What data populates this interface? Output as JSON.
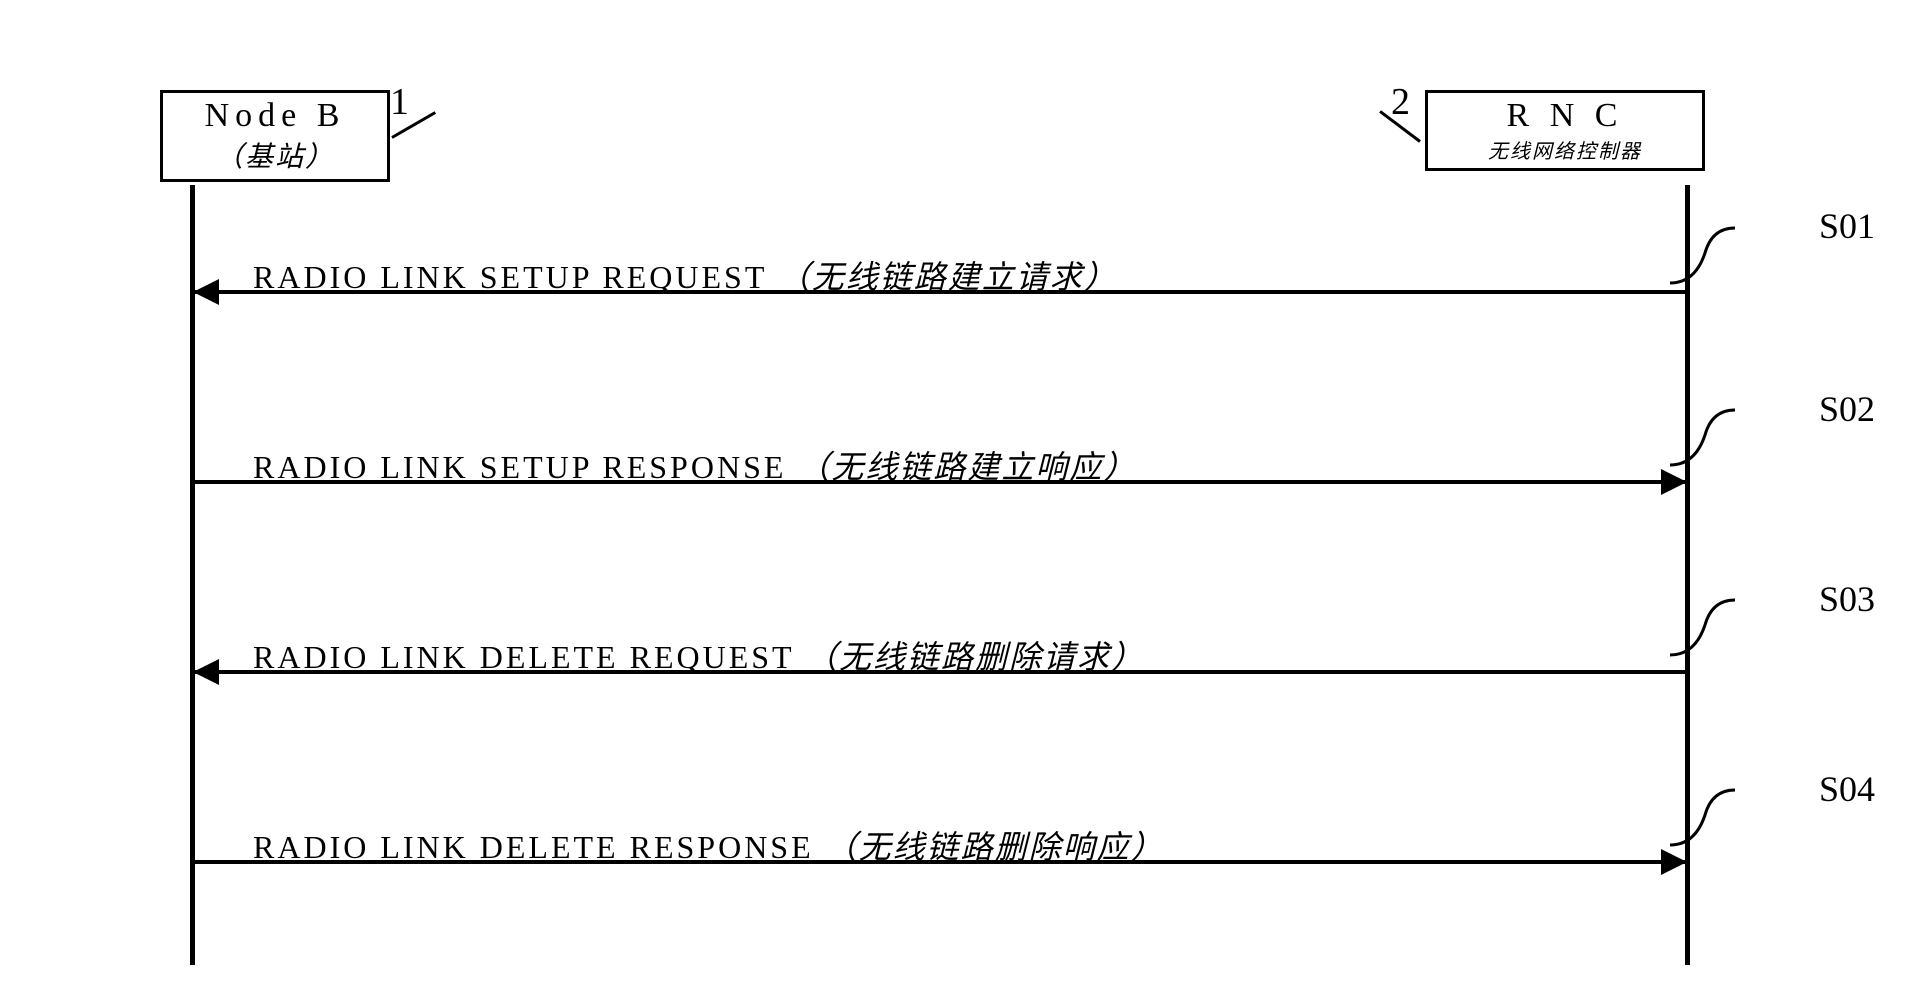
{
  "participants": {
    "left": {
      "title": "Node B",
      "subtitle": "（基站）",
      "label": "1"
    },
    "right": {
      "title": "R  N  C",
      "subtitle": "无线网络控制器",
      "label": "2"
    }
  },
  "messages": [
    {
      "step": "S01",
      "text_en": "RADIO LINK SETUP REQUEST",
      "text_cn": "（无线链路建立请求）",
      "direction": "left"
    },
    {
      "step": "S02",
      "text_en": "RADIO LINK SETUP RESPONSE",
      "text_cn": "（无线链路建立响应）",
      "direction": "right"
    },
    {
      "step": "S03",
      "text_en": "RADIO LINK DELETE REQUEST",
      "text_cn": "（无线链路删除请求）",
      "direction": "left"
    },
    {
      "step": "S04",
      "text_en": "RADIO LINK DELETE RESPONSE",
      "text_cn": "（无线链路删除响应）",
      "direction": "right"
    }
  ],
  "chart_data": {
    "type": "sequence-diagram",
    "participants": [
      "Node B (基站)",
      "RNC (无线网络控制器)"
    ],
    "messages": [
      {
        "id": "S01",
        "from": "RNC",
        "to": "Node B",
        "label": "RADIO LINK SETUP REQUEST (无线链路建立请求)"
      },
      {
        "id": "S02",
        "from": "Node B",
        "to": "RNC",
        "label": "RADIO LINK SETUP RESPONSE (无线链路建立响应)"
      },
      {
        "id": "S03",
        "from": "RNC",
        "to": "Node B",
        "label": "RADIO LINK DELETE REQUEST (无线链路删除请求)"
      },
      {
        "id": "S04",
        "from": "Node B",
        "to": "RNC",
        "label": "RADIO LINK DELETE RESPONSE (无线链路删除响应)"
      }
    ]
  }
}
